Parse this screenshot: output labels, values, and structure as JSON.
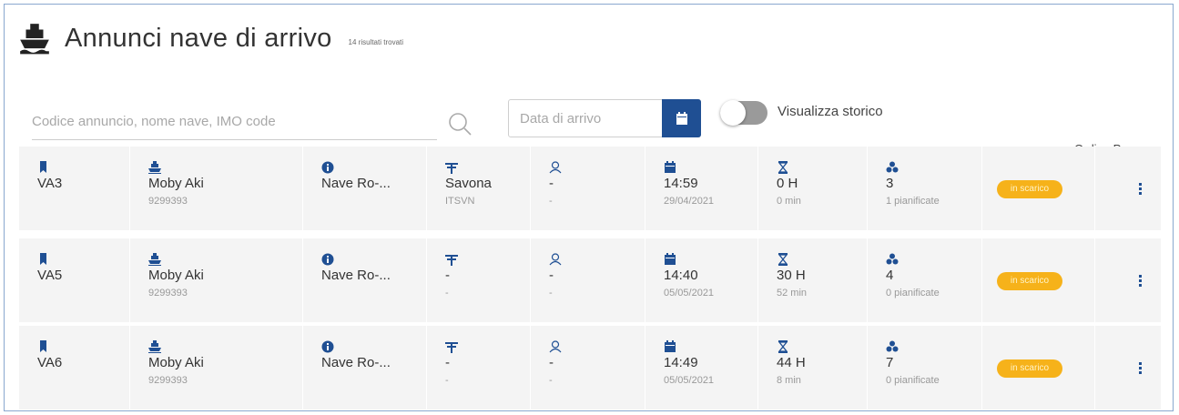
{
  "header": {
    "title": "Annunci nave di arrivo",
    "result_count": "14 risultati trovati"
  },
  "filters": {
    "search_placeholder": "Codice annuncio, nome nave, IMO code",
    "date_placeholder": "Data di arrivo",
    "history_toggle_label": "Visualizza storico",
    "history_toggle_on": false,
    "sort_label": "Ordina Per"
  },
  "colors": {
    "accent": "#1f4f93",
    "badge": "#f6b21a",
    "row_bg": "#f4f4f4"
  },
  "icons": [
    "ship-icon",
    "search-icon",
    "calendar-icon",
    "bookmark-icon",
    "info-icon",
    "port-icon",
    "user-icon",
    "hourglass-icon",
    "cluster-icon",
    "more-vert-icon"
  ],
  "rows": [
    {
      "code": "VA3",
      "ship_name": "Moby Aki",
      "imo": "9299393",
      "type": "Nave Ro-...",
      "port": "Savona",
      "port_code": "ITSVN",
      "agent": "-",
      "agent_sub": "-",
      "time": "14:59",
      "date": "29/04/2021",
      "duration_h": "0 H",
      "duration_m": "0 min",
      "count": "3",
      "planned": "1 pianificate",
      "status": "in scarico"
    },
    {
      "code": "VA5",
      "ship_name": "Moby Aki",
      "imo": "9299393",
      "type": "Nave Ro-...",
      "port": "-",
      "port_code": "-",
      "agent": "-",
      "agent_sub": "-",
      "time": "14:40",
      "date": "05/05/2021",
      "duration_h": "30 H",
      "duration_m": "52 min",
      "count": "4",
      "planned": "0 pianificate",
      "status": "in scarico"
    },
    {
      "code": "VA6",
      "ship_name": "Moby Aki",
      "imo": "9299393",
      "type": "Nave Ro-...",
      "port": "-",
      "port_code": "-",
      "agent": "-",
      "agent_sub": "-",
      "time": "14:49",
      "date": "05/05/2021",
      "duration_h": "44 H",
      "duration_m": "8 min",
      "count": "7",
      "planned": "0 pianificate",
      "status": "in scarico"
    }
  ]
}
